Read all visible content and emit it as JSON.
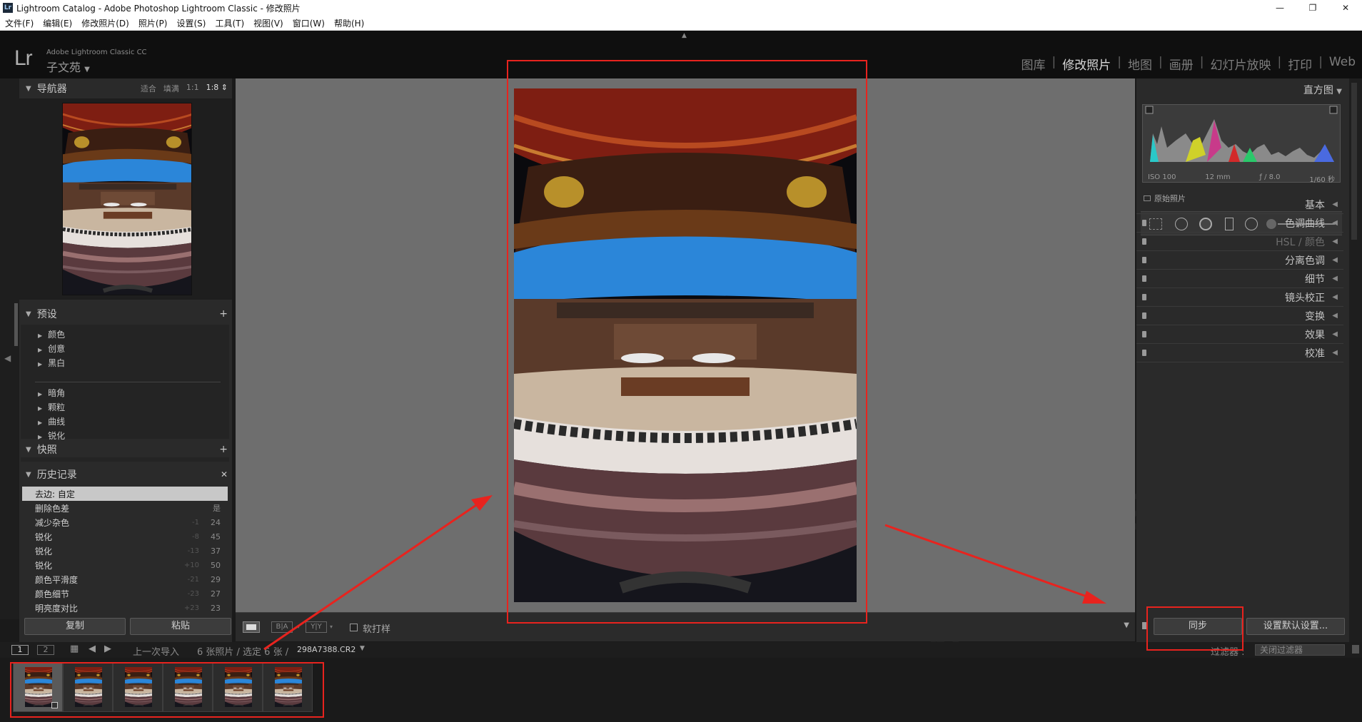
{
  "window": {
    "title": "Lightroom Catalog - Adobe Photoshop Lightroom Classic - 修改照片",
    "app_icon": "Lr",
    "minimize": "—",
    "restore": "❐",
    "close": "✕"
  },
  "menu": [
    "文件(F)",
    "编辑(E)",
    "修改照片(D)",
    "照片(P)",
    "设置(S)",
    "工具(T)",
    "视图(V)",
    "窗口(W)",
    "帮助(H)"
  ],
  "identity": {
    "logo": "Lr",
    "product": "Adobe Lightroom Classic CC",
    "plate": "子文苑",
    "plate_arrow": "▼"
  },
  "modules": [
    "图库",
    "修改照片",
    "地图",
    "画册",
    "幻灯片放映",
    "打印",
    "Web"
  ],
  "active_module": "修改照片",
  "navigator": {
    "title": "导航器",
    "zoom_options": [
      "适合",
      "填满",
      "1:1"
    ],
    "current_zoom": "1:8",
    "zoom_arrow": "⇕"
  },
  "presets": {
    "title": "预设",
    "add": "+",
    "groups_a": [
      "颜色",
      "创意",
      "黑白"
    ],
    "groups_b": [
      "暗角",
      "颗粒",
      "曲线",
      "锐化"
    ]
  },
  "snapshots": {
    "title": "快照",
    "add": "+"
  },
  "history": {
    "title": "历史记录",
    "clear": "✕",
    "rows": [
      {
        "name": "去边: 自定",
        "a": "",
        "b": ""
      },
      {
        "name": "删除色差",
        "a": "",
        "b": "是"
      },
      {
        "name": "减少杂色",
        "a": "-1",
        "b": "24"
      },
      {
        "name": "锐化",
        "a": "-8",
        "b": "45"
      },
      {
        "name": "锐化",
        "a": "-13",
        "b": "37"
      },
      {
        "name": "锐化",
        "a": "+10",
        "b": "50"
      },
      {
        "name": "颜色平滑度",
        "a": "-21",
        "b": "29"
      },
      {
        "name": "颜色细节",
        "a": "-23",
        "b": "27"
      },
      {
        "name": "明亮度对比",
        "a": "+23",
        "b": "23"
      }
    ]
  },
  "left_buttons": {
    "copy": "复制",
    "paste": "粘贴"
  },
  "toolbar": {
    "soft_proof": "软打样",
    "ba_label": "B|A",
    "yy_label": "Y|Y"
  },
  "histogram": {
    "title": "直方图",
    "iso": "ISO 100",
    "focal": "12 mm",
    "aperture": "ƒ / 8.0",
    "shutter": "1/60 秒",
    "original": "原始照片"
  },
  "right_sections": [
    "基本",
    "色调曲线",
    "HSL / 颜色",
    "分离色调",
    "细节",
    "镜头校正",
    "变换",
    "效果",
    "校准"
  ],
  "right_buttons": {
    "sync": "同步",
    "reset": "设置默认设置..."
  },
  "filmbar": {
    "page1": "1",
    "page2": "2",
    "source": "上一次导入",
    "count": "6 张照片 / 选定 6 张 /",
    "filename": "298A7388.CR2",
    "filter_label": "过滤器 :",
    "filter_value": "关闭过滤器"
  },
  "colors": {
    "annotation": "#e8231e",
    "accent_sky": "#2b86d9",
    "roof": "#8a2214"
  }
}
